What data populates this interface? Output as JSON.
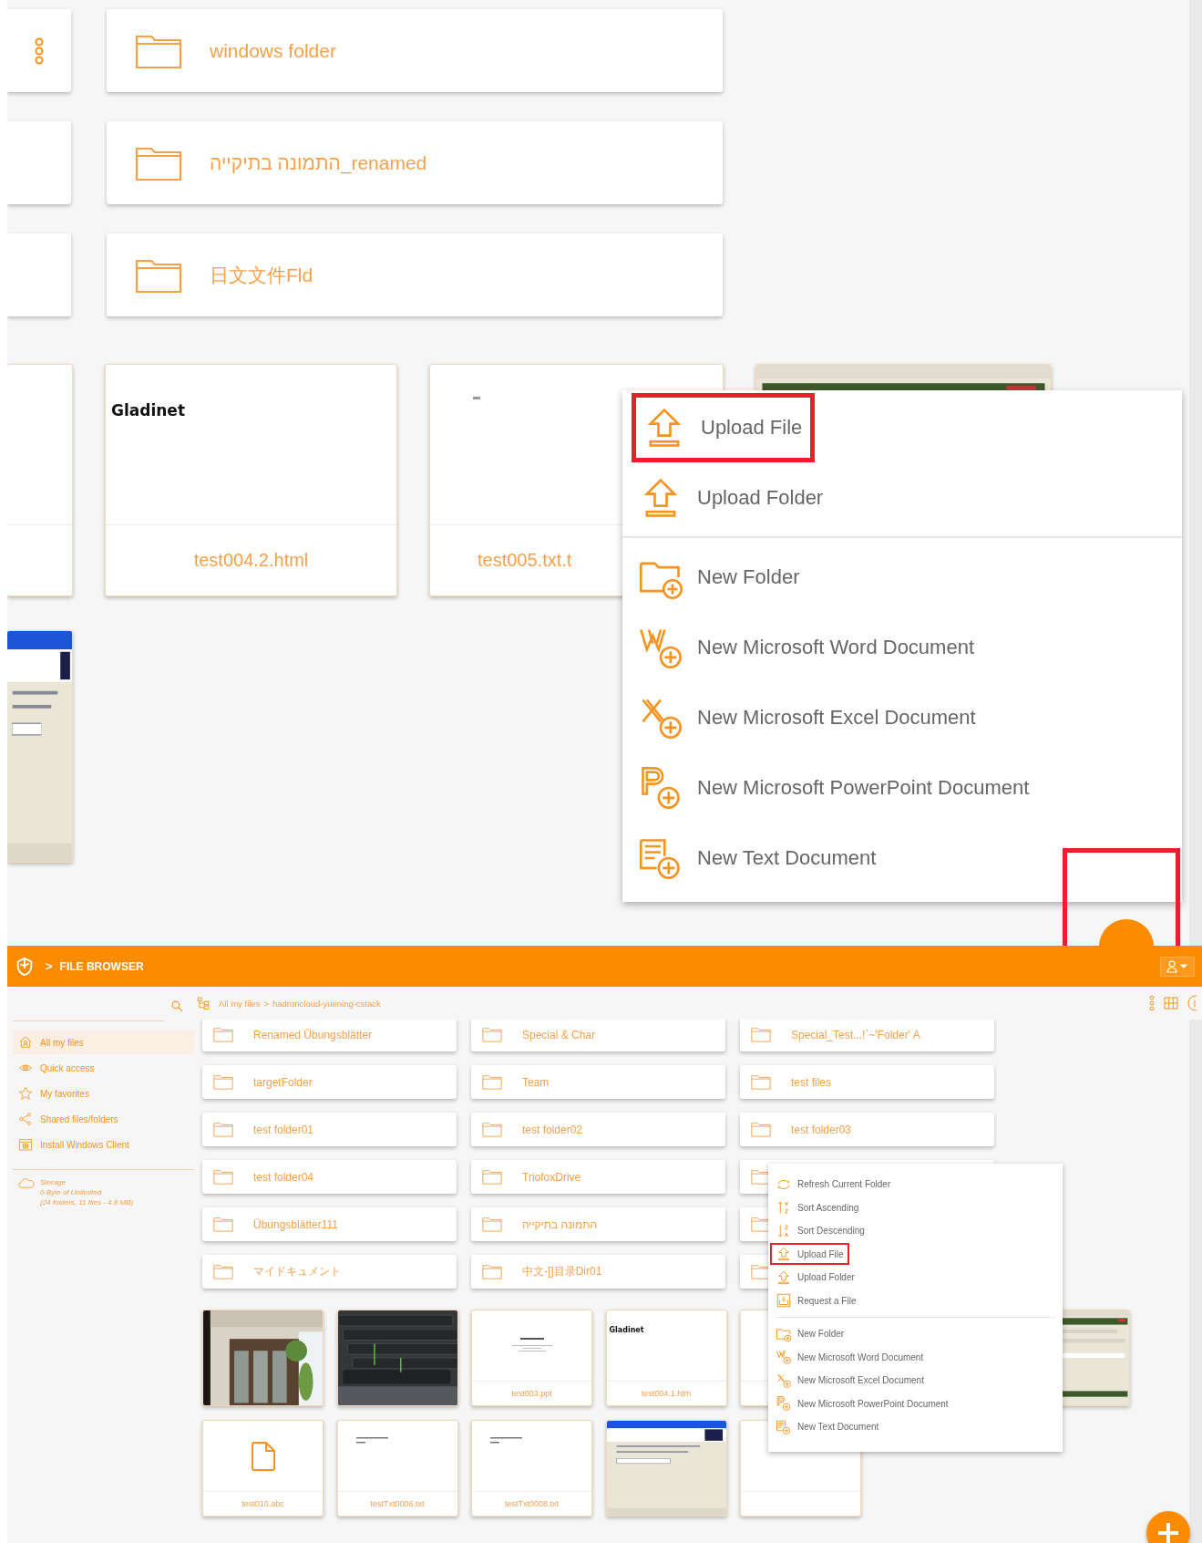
{
  "top_view": {
    "cut_cards": [
      {
        "kind": "menu"
      },
      {
        "kind": "plain"
      },
      {
        "kind": "plain"
      }
    ],
    "folders": [
      {
        "name": "windows folder"
      },
      {
        "name": "התמונה בתיקייה_renamed"
      },
      {
        "name": "日文文件Fld"
      }
    ],
    "cut_files": [
      {
        "kind": "plain"
      },
      {
        "kind": "screenshot"
      }
    ],
    "files": [
      {
        "kind": "document",
        "name": "test004.2.html",
        "preview": "Gladinet",
        "clipped": false
      },
      {
        "kind": "document",
        "name": "test005.txt.t",
        "clipped": true
      },
      {
        "kind": "screenshot"
      }
    ],
    "menu": [
      {
        "kind": "upload",
        "label": "Upload File",
        "annotated": true
      },
      {
        "kind": "upload",
        "label": "Upload Folder",
        "annotated": false
      },
      {
        "kind": "divider"
      },
      {
        "kind": "folder",
        "label": "New Folder",
        "annotated": false
      },
      {
        "kind": "word",
        "label": "New Microsoft Word Document",
        "annotated": false
      },
      {
        "kind": "excel",
        "label": "New Microsoft Excel Document",
        "annotated": false
      },
      {
        "kind": "powerpoint",
        "label": "New Microsoft PowerPoint Document",
        "annotated": false
      },
      {
        "kind": "text",
        "label": "New Text Document",
        "annotated": false
      }
    ],
    "fab": {
      "annotated": true
    }
  },
  "app": {
    "header": {
      "separator": ">",
      "title": "FILE BROWSER"
    },
    "sidebar": {
      "items": [
        {
          "kind": "home",
          "label": "All my files",
          "selected": true
        },
        {
          "kind": "eye",
          "label": "Quick access",
          "selected": false
        },
        {
          "kind": "star",
          "label": "My favorites",
          "selected": false
        },
        {
          "kind": "share",
          "label": "Shared files/folders",
          "selected": false
        },
        {
          "kind": "window",
          "label": "Install Windows Client",
          "selected": false
        }
      ],
      "storage": {
        "title": "Storage",
        "usage": "0 Byte of Unlimited",
        "summary": "(24 folders, 11 files - 4.8 MB)"
      }
    },
    "breadcrumb": {
      "separator": ">",
      "items": [
        "All my files",
        "hadroncloud-yuening-cstack"
      ]
    },
    "folders": [
      {
        "name": "Renamed Übungsblätter"
      },
      {
        "name": "Special & Char"
      },
      {
        "name": "Special_Test...!`~'Folder' A"
      },
      {
        "name": "targetFolder"
      },
      {
        "name": "Team"
      },
      {
        "name": "test files"
      },
      {
        "name": "test folder01"
      },
      {
        "name": "test folder02"
      },
      {
        "name": "test folder03"
      },
      {
        "name": "test folder04"
      },
      {
        "name": "TriofoxDrive"
      },
      {
        "kind": "partial"
      },
      {
        "name": "Übungsblätter111"
      },
      {
        "name": "התמונה בתיקייה"
      },
      {
        "kind": "partial"
      },
      {
        "name": "マイドキュメント"
      },
      {
        "name": "中文-[]目录Dir01"
      },
      {
        "kind": "partial"
      }
    ],
    "files": [
      {
        "kind": "picture"
      },
      {
        "kind": "picture"
      },
      {
        "kind": "document",
        "name": "test003.ppt"
      },
      {
        "kind": "document",
        "name": "test004.1.htm",
        "preview": "Gladinet"
      },
      {
        "kind": "plain"
      },
      {
        "kind": "screenshot"
      },
      {
        "kind": "file",
        "name": "test010.abc"
      },
      {
        "kind": "document",
        "name": "testTxt0006.txt"
      },
      {
        "kind": "document",
        "name": "testTxt0008.txt"
      },
      {
        "kind": "screenshot"
      },
      {
        "kind": "plain"
      }
    ],
    "menu": [
      {
        "kind": "refresh",
        "label": "Refresh Current Folder",
        "annotated": false
      },
      {
        "kind": "ascending",
        "label": "Sort Ascending",
        "annotated": false
      },
      {
        "kind": "descending",
        "label": "Sort Descending",
        "annotated": false
      },
      {
        "kind": "upload",
        "label": "Upload File",
        "annotated": true
      },
      {
        "kind": "upload",
        "label": "Upload Folder",
        "annotated": false
      },
      {
        "kind": "request",
        "label": "Request a File",
        "annotated": false
      },
      {
        "kind": "divider"
      },
      {
        "kind": "folder",
        "label": "New Folder",
        "annotated": false
      },
      {
        "kind": "word",
        "label": "New Microsoft Word Document",
        "annotated": false
      },
      {
        "kind": "excel",
        "label": "New Microsoft Excel Document",
        "annotated": false
      },
      {
        "kind": "powerpoint",
        "label": "New Microsoft PowerPoint Document",
        "annotated": false
      },
      {
        "kind": "text",
        "label": "New Text Document",
        "annotated": false
      }
    ]
  }
}
